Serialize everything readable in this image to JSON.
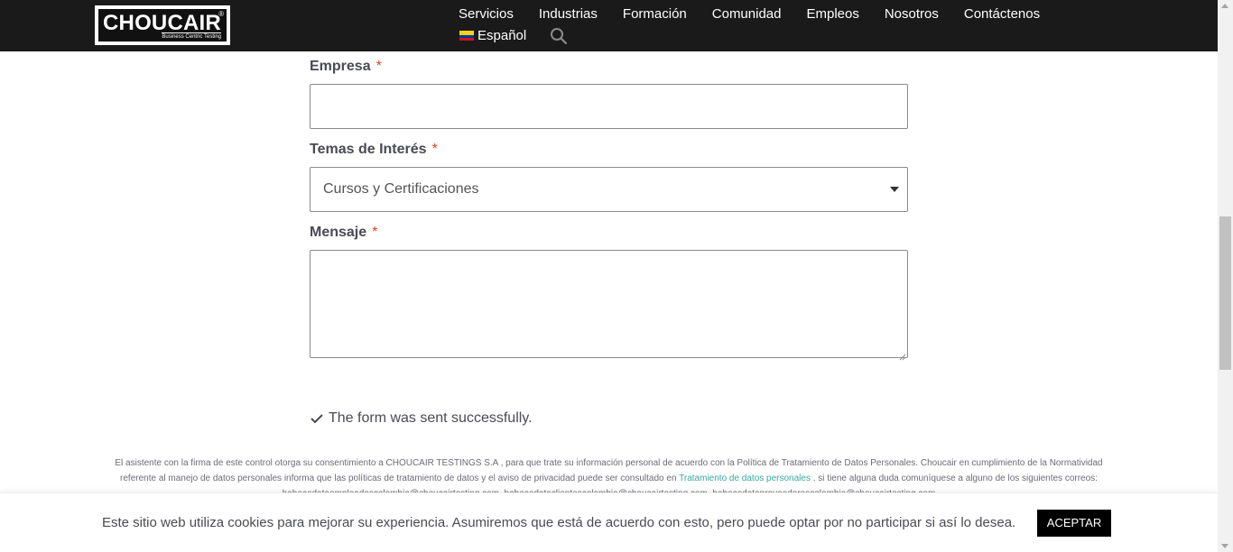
{
  "brand": {
    "name": "CHOUCAIR",
    "tagline": "Business Centric Testing",
    "reg_mark": "®"
  },
  "nav": {
    "items": [
      "Servicios",
      "Industrias",
      "Formación",
      "Comunidad",
      "Empleos",
      "Nosotros",
      "Contáctenos"
    ],
    "language": "Español",
    "icons": {
      "flag": "colombia-flag-icon",
      "search": "search-icon"
    }
  },
  "form": {
    "empresa": {
      "label": "Empresa",
      "required_mark": "*",
      "value": ""
    },
    "temas": {
      "label": "Temas de Interés",
      "required_mark": "*",
      "selected": "Cursos y Certificaciones"
    },
    "mensaje": {
      "label": "Mensaje",
      "required_mark": "*",
      "value": ""
    },
    "success_message": "The form was sent successfully."
  },
  "legal": {
    "text_1": "El asistente con la firma de este control otorga su consentimiento a CHOUCAIR TESTINGS S.A , para que trate su información personal de acuerdo con la Política de Tratamiento de Datos Personales. Choucair en cumplimiento de la Normatividad referente al manejo de datos personales informa que las políticas de tratamiento de datos y el aviso de privacidad puede ser consultado en",
    "link": "Tratamiento de datos personales",
    "text_2": ". si tiene alguna duda comuníquese a alguno de los siguientes correos: habeasdataempleadoscolombia@choucairtesting.com, habeasdataclientescolombia@choucairtesting.com, habeasdataproveedorescolombia@choucairtesting.com"
  },
  "cookie": {
    "text": "Este sitio web utiliza cookies para mejorar su experiencia. Asumiremos que está de acuerdo con esto, pero puede optar por no participar si así lo desea.",
    "accept_label": "ACEPTAR"
  },
  "colors": {
    "header_bg": "#1a1a1a",
    "required": "#e2401c",
    "link": "#3aa89b",
    "button_bg": "#000000"
  }
}
